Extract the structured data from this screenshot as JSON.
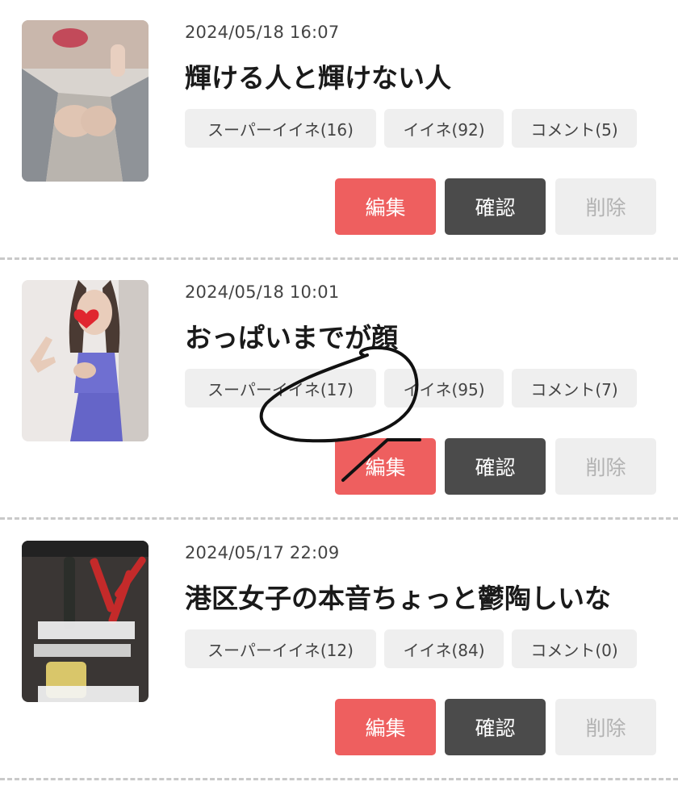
{
  "posts": [
    {
      "date": "2024/05/18 16:07",
      "title": "輝ける人と輝けない人",
      "super_like": "スーパーイイネ(16)",
      "like": "イイネ(92)",
      "comment": "コメント(5)",
      "edit_label": "編集",
      "confirm_label": "確認",
      "delete_label": "削除"
    },
    {
      "date": "2024/05/18 10:01",
      "title": "おっぱいまでが顔",
      "super_like": "スーパーイイネ(17)",
      "like": "イイネ(95)",
      "comment": "コメント(7)",
      "edit_label": "編集",
      "confirm_label": "確認",
      "delete_label": "削除"
    },
    {
      "date": "2024/05/17 22:09",
      "title": "港区女子の本音ちょっと鬱陶しいな",
      "super_like": "スーパーイイネ(12)",
      "like": "イイネ(84)",
      "comment": "コメント(0)",
      "edit_label": "編集",
      "confirm_label": "確認",
      "delete_label": "削除"
    }
  ],
  "colors": {
    "edit": "#ee5f5f",
    "confirm": "#4b4b4b",
    "delete_bg": "#eeeeee",
    "delete_text": "#b2b2b2",
    "stat_bg": "#efefef",
    "divider": "#c9c9c9"
  }
}
